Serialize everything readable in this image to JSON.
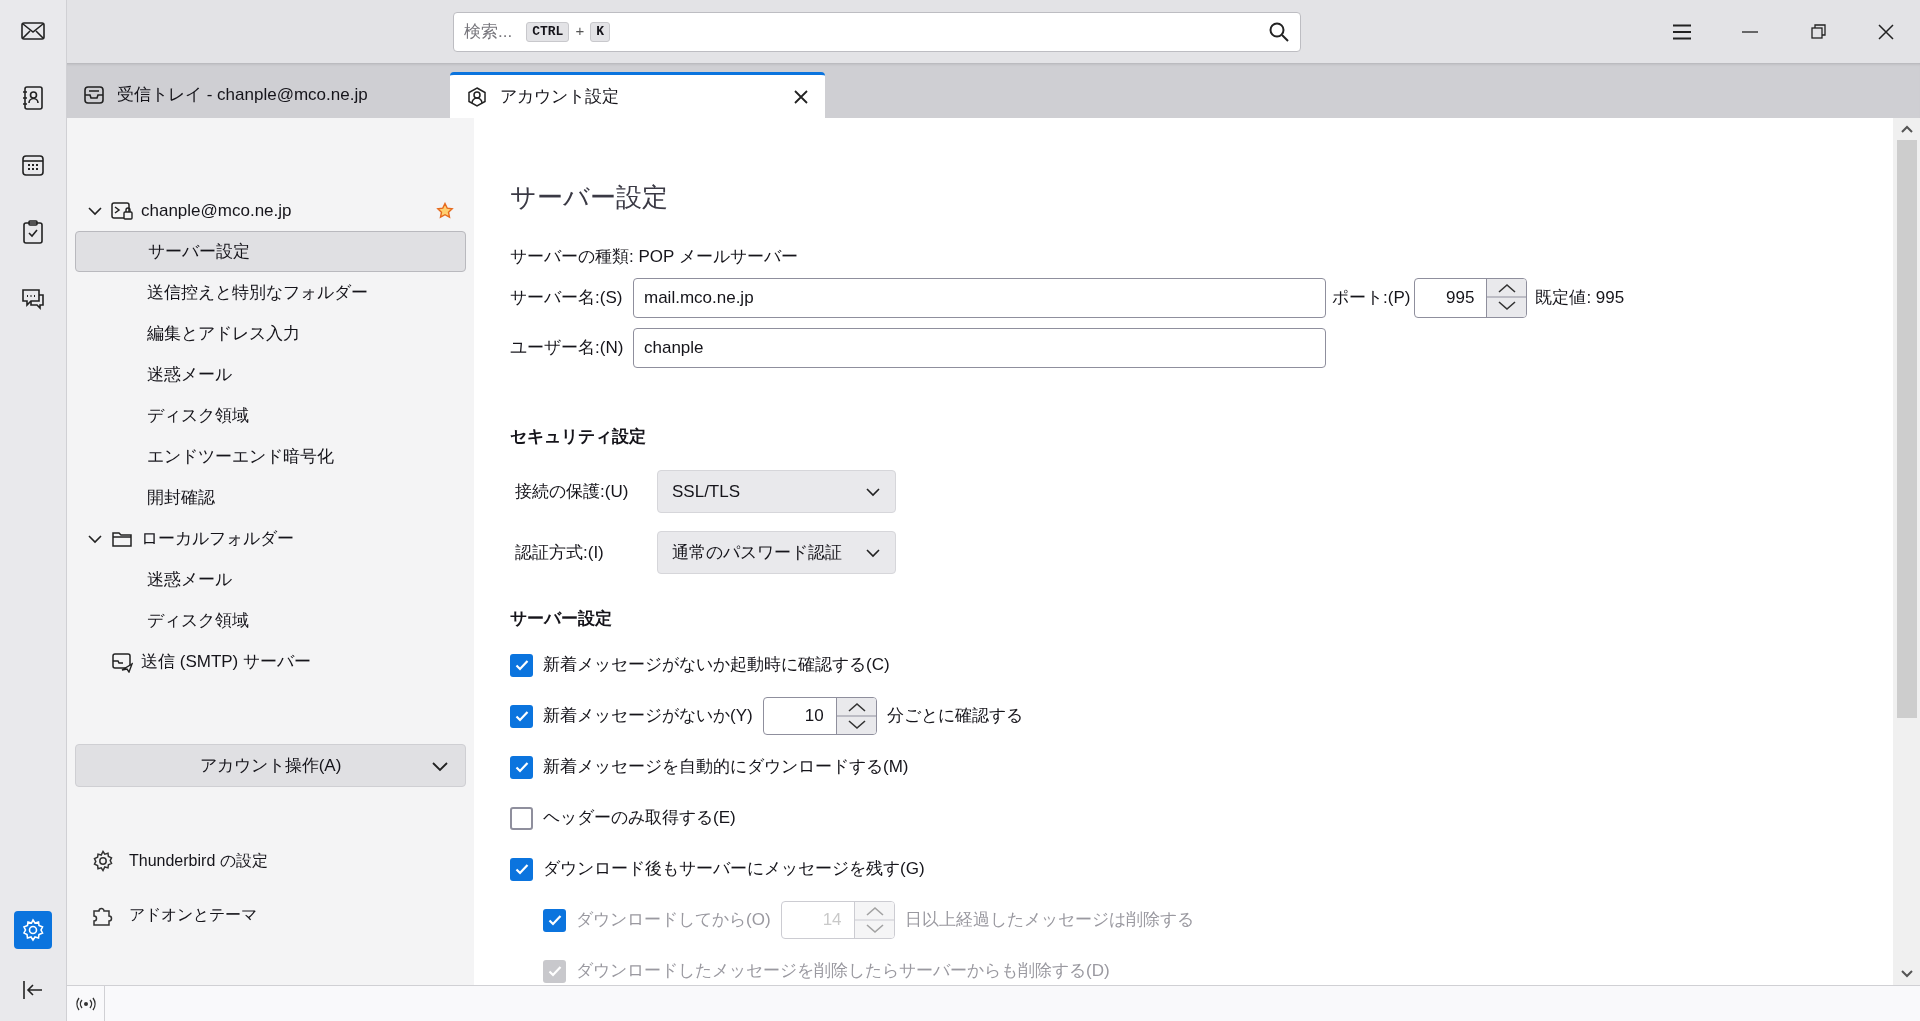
{
  "spaces_bar": {
    "items": [
      {
        "kind": "mail",
        "selected": false
      },
      {
        "kind": "address-book",
        "selected": false
      },
      {
        "kind": "calendar",
        "selected": false
      },
      {
        "kind": "tasks",
        "selected": false
      },
      {
        "kind": "chat",
        "selected": false
      }
    ],
    "bottom": [
      {
        "kind": "settings",
        "selected": true
      },
      {
        "kind": "collapse",
        "selected": false
      }
    ]
  },
  "search": {
    "placeholder": "検索...",
    "shortcut": [
      "CTRL",
      "+",
      "K"
    ]
  },
  "tabs": [
    {
      "label": "受信トレイ - chanple@mco.ne.jp",
      "kind": "inbox",
      "selected": false,
      "closable": false
    },
    {
      "label": "アカウント設定",
      "kind": "account",
      "selected": true,
      "closable": true
    }
  ],
  "account_tree": [
    {
      "label": "chanple@mco.ne.jp",
      "kind": "account",
      "expanded": true,
      "default": true,
      "selected": false,
      "children": [
        {
          "label": "サーバー設定",
          "selected": true
        },
        {
          "label": "送信控えと特別なフォルダー",
          "selected": false
        },
        {
          "label": "編集とアドレス入力",
          "selected": false
        },
        {
          "label": "迷惑メール",
          "selected": false
        },
        {
          "label": "ディスク領域",
          "selected": false
        },
        {
          "label": "エンドツーエンド暗号化",
          "selected": false
        },
        {
          "label": "開封確認",
          "selected": false
        }
      ]
    },
    {
      "label": "ローカルフォルダー",
      "kind": "folder",
      "expanded": true,
      "default": false,
      "selected": false,
      "children": [
        {
          "label": "迷惑メール",
          "selected": false
        },
        {
          "label": "ディスク領域",
          "selected": false
        }
      ]
    },
    {
      "label": "送信 (SMTP) サーバー",
      "kind": "smtp",
      "default": false,
      "selected": false
    }
  ],
  "account_actions": {
    "label": "アカウント操作(A)"
  },
  "footer_links": [
    {
      "label": "Thunderbird の設定",
      "kind": "gear"
    },
    {
      "label": "アドオンとテーマ",
      "kind": "puzzle"
    }
  ],
  "page_title": "サーバー設定",
  "server_type": "サーバーの種類: POP メールサーバー",
  "server_name": {
    "label": "サーバー名:(S)",
    "value": "mail.mco.ne.jp"
  },
  "port": {
    "label": "ポート:(P)",
    "value": "995",
    "default_text": "既定値: 995"
  },
  "user_name": {
    "label": "ユーザー名:(N)",
    "value": "chanple"
  },
  "security": {
    "heading": "セキュリティ設定",
    "selects": [
      {
        "label": "接続の保護:(U)",
        "value": "SSL/TLS"
      },
      {
        "label": "認証方式:(I)",
        "value": "通常のパスワード認証"
      }
    ]
  },
  "server_settings": {
    "heading": "サーバー設定",
    "options": [
      {
        "kind": "check",
        "label": "新着メッセージがないか起動時に確認する(C)",
        "checked": true,
        "disabled": false,
        "box_disabled": false
      },
      {
        "kind": "spinner",
        "label": "新着メッセージがないか(Y)",
        "value": "10",
        "suffix": "分ごとに確認する",
        "checked": true,
        "disabled": false,
        "box_disabled": false
      },
      {
        "kind": "check",
        "label": "新着メッセージを自動的にダウンロードする(M)",
        "checked": true,
        "disabled": false,
        "box_disabled": false
      },
      {
        "kind": "check",
        "label": "ヘッダーのみ取得する(E)",
        "checked": false,
        "disabled": false,
        "box_disabled": false
      },
      {
        "kind": "check",
        "label": "ダウンロード後もサーバーにメッセージを残す(G)",
        "checked": true,
        "disabled": false,
        "box_disabled": false,
        "children": [
          {
            "kind": "spinner",
            "label": "ダウンロードしてから(O)",
            "value": "14",
            "suffix": "日以上経過したメッセージは削除する",
            "checked": true,
            "disabled": true,
            "box_disabled": false
          },
          {
            "kind": "check",
            "label": "ダウンロードしたメッセージを削除したらサーバーからも削除する(D)",
            "checked": true,
            "disabled": true,
            "box_disabled": true
          }
        ]
      }
    ]
  }
}
